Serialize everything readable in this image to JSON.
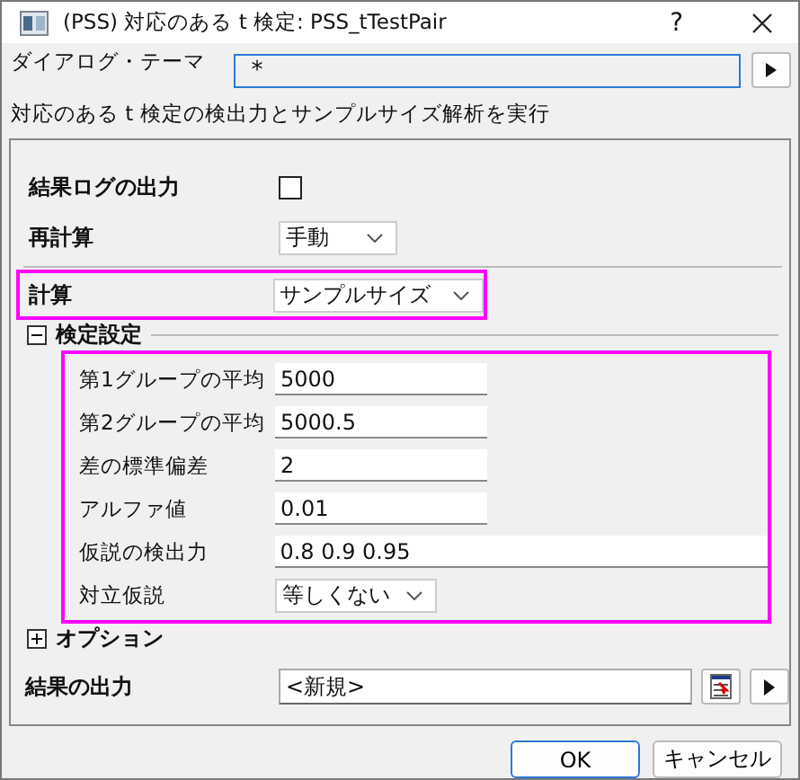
{
  "window": {
    "title": "(PSS) 対応のある t 検定: PSS_tTestPair",
    "help": "?"
  },
  "theme": {
    "label": "ダイアログ・テーマ",
    "value": "*"
  },
  "description": "対応のある t 検定の検出力とサンプルサイズ解析を実行",
  "rows": [
    {
      "kind": "checkbox",
      "label": "結果ログの出力",
      "checked": false,
      "highlighted": false
    },
    {
      "kind": "dropdown",
      "label": "再計算",
      "value": "手動",
      "highlighted": false
    },
    {
      "kind": "dropdown",
      "label": "計算",
      "value": "サンプルサイズ",
      "highlighted": true
    }
  ],
  "sections": [
    {
      "title": "検定設定",
      "expanded": true,
      "highlighted": true,
      "fields": [
        {
          "kind": "text",
          "label": "第1グループの平均",
          "value": "5000"
        },
        {
          "kind": "text",
          "label": "第2グループの平均",
          "value": "5000.5"
        },
        {
          "kind": "text",
          "label": "差の標準偏差",
          "value": "2"
        },
        {
          "kind": "text",
          "label": "アルファ値",
          "value": "0.01"
        },
        {
          "kind": "wide",
          "label": "仮説の検出力",
          "value": "0.8 0.9 0.95"
        },
        {
          "kind": "dropdown",
          "label": "対立仮説",
          "value": "等しくない"
        }
      ]
    },
    {
      "title": "オプション",
      "expanded": false
    }
  ],
  "output": {
    "label": "結果の出力",
    "value": "<新規>"
  },
  "buttons": [
    {
      "label": "OK",
      "default": true
    },
    {
      "label": "キャンセル",
      "default": false
    }
  ]
}
